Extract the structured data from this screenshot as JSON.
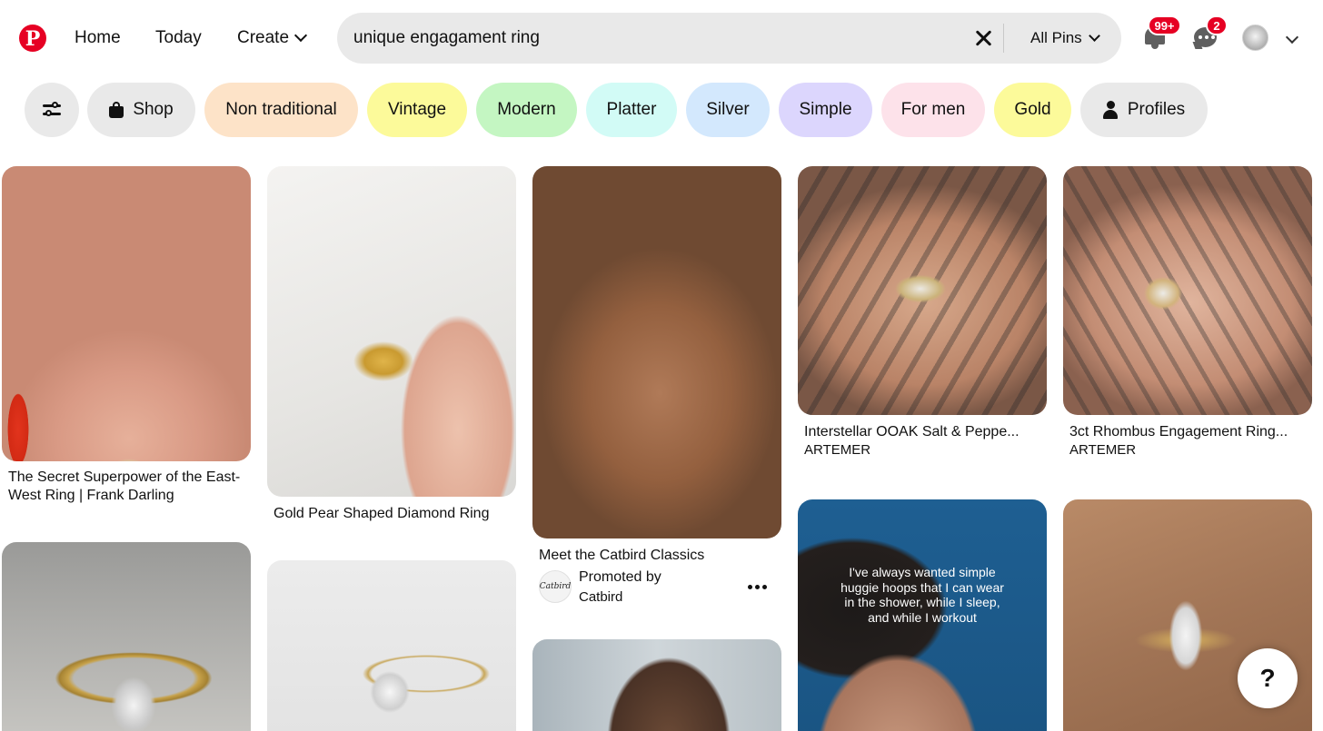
{
  "brand": {
    "logo_letter": "P",
    "accent_color": "#e60023"
  },
  "nav": {
    "home": "Home",
    "today": "Today",
    "create": "Create"
  },
  "search": {
    "query": "unique engagament ring",
    "scope": "All Pins"
  },
  "header_icons": {
    "notifications_badge": "99+",
    "messages_badge": "2"
  },
  "filters": {
    "chips": [
      {
        "label": "Shop",
        "color": "#e9e9e9"
      },
      {
        "label": "Non traditional",
        "color": "#fde3c8"
      },
      {
        "label": "Vintage",
        "color": "#fcfa9a"
      },
      {
        "label": "Modern",
        "color": "#c4f6c2"
      },
      {
        "label": "Platter",
        "color": "#d2fbf6"
      },
      {
        "label": "Silver",
        "color": "#d3e8fd"
      },
      {
        "label": "Simple",
        "color": "#dcd6fd"
      },
      {
        "label": "For men",
        "color": "#fde2ea"
      },
      {
        "label": "Gold",
        "color": "#fcfa9a"
      },
      {
        "label": "Profiles",
        "color": "#e9e9e9"
      }
    ]
  },
  "pins": [
    {
      "title": "The Secret Superpower of the East-West Ring | Frank Darling"
    },
    {
      "title": "Gold Pear Shaped Diamond Ring"
    },
    {
      "title": "Meet the Catbird Classics",
      "promoted_label": "Promoted by",
      "promoter": "Catbird",
      "promoter_logo_text": "Catbird"
    },
    {
      "title": "Interstellar OOAK Salt & Peppe...",
      "creator": "ARTEMER"
    },
    {
      "title": "3ct Rhombus Engagement Ring...",
      "creator": "ARTEMER"
    }
  ],
  "video_pin_caption": [
    "I've always wanted simple",
    "huggie hoops that I can wear",
    "in the shower, while I sleep,",
    "and while I workout"
  ],
  "help": {
    "label": "?"
  }
}
